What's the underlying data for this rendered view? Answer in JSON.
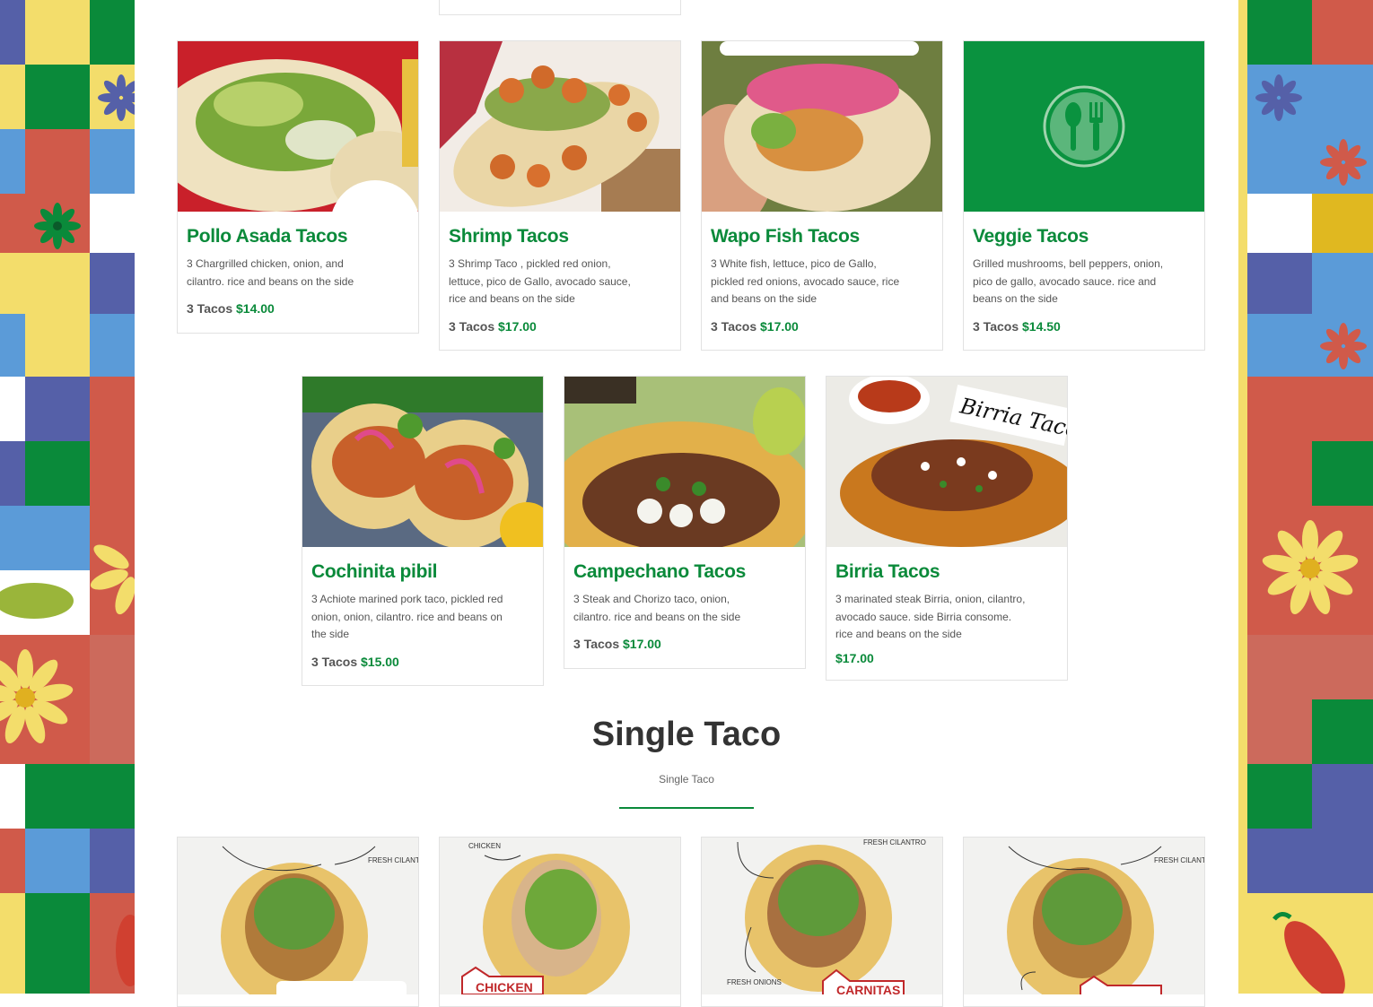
{
  "menu": {
    "row1": [
      {
        "title": "Pollo Asada Tacos",
        "desc": "3 Chargrilled chicken, onion, and cilantro. rice and beans on the side",
        "qty": "3 Tacos",
        "price": "$14.00"
      },
      {
        "title": "Shrimp Tacos",
        "desc": "3 Shrimp Taco , pickled red onion, lettuce, pico de Gallo, avocado sauce, rice and beans on the side",
        "qty": "3 Tacos",
        "price": "$17.00"
      },
      {
        "title": "Wapo Fish Tacos",
        "desc": "3 White fish, lettuce, pico de Gallo, pickled red onions, avocado sauce, rice and beans on the side",
        "qty": "3 Tacos",
        "price": "$17.00"
      },
      {
        "title": "Veggie Tacos",
        "desc": "Grilled mushrooms, bell peppers, onion, pico de gallo, avocado sauce. rice and beans on the side",
        "qty": "3 Tacos",
        "price": "$14.50"
      }
    ],
    "row2": [
      {
        "title": "Cochinita pibil",
        "desc": "3 Achiote marined pork taco, pickled red onion, onion, cilantro. rice and beans on the side",
        "qty": "3 Tacos",
        "price": "$15.00"
      },
      {
        "title": "Campechano Tacos",
        "desc": "3 Steak and Chorizo taco, onion, cilantro. rice and beans on the side",
        "qty": "3 Tacos",
        "price": "$17.00"
      },
      {
        "title": "Birria Tacos",
        "desc": "3 marinated steak Birria, onion, cilantro, avocado sauce. side Birria consome. rice and beans on the side",
        "qty": "",
        "price": "$17.00",
        "image_label": "Birria Taco"
      }
    ]
  },
  "single_section": {
    "title": "Single Taco",
    "subtitle": "Single Taco",
    "cards": [
      {
        "image_labels": [
          "FRESH CILANTRO"
        ]
      },
      {
        "image_labels": [
          "CHICKEN",
          "CHICKEN"
        ]
      },
      {
        "image_labels": [
          "FRESH CILANTRO",
          "FRESH ONIONS",
          "CARNITAS"
        ]
      },
      {
        "image_labels": [
          "FRESH CILANTRO"
        ]
      }
    ]
  },
  "colors": {
    "accent": "#0a8a3a",
    "text": "#555555",
    "heading": "#333333",
    "veggie_bg": "#0a923f"
  }
}
